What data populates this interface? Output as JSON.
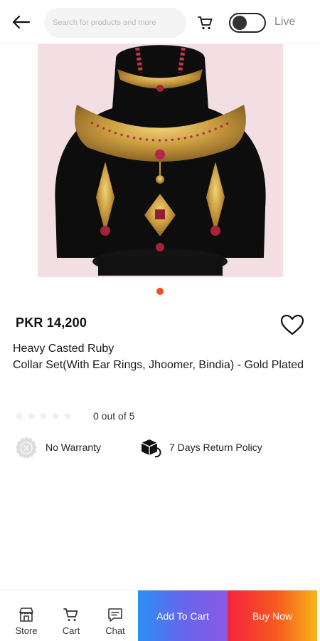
{
  "header": {
    "back_icon": "arrow-left-icon",
    "search_placeholder": "Search for products and more",
    "cart_icon": "cart-icon",
    "live_toggle": {
      "state": "off",
      "label": "Live"
    }
  },
  "product": {
    "image_description_icon": "jewelry-photo",
    "image_count": 1,
    "active_image": 1,
    "price": "PKR 14,200",
    "title": "Heavy Casted Ruby\nCollar  Set(With Ear Rings, Jhoomer, Bindia) - Gold Plated",
    "rating": {
      "value": 0,
      "max": 5,
      "text": "0 out of 5"
    },
    "warranty": {
      "icon": "no-warranty-icon",
      "text": "No Warranty"
    },
    "return_policy": {
      "icon": "return-box-icon",
      "text": "7 Days Return Policy"
    },
    "wishlist_icon": "heart-icon"
  },
  "bottom_nav": {
    "items": [
      {
        "label": "Store",
        "icon": "store-icon"
      },
      {
        "label": "Cart",
        "icon": "cart-icon"
      },
      {
        "label": "Chat",
        "icon": "chat-icon"
      }
    ],
    "add_to_cart_label": "Add To Cart",
    "buy_now_label": "Buy Now"
  },
  "colors": {
    "accent_dot": "#f04c1e",
    "add_to_cart_gradient": [
      "#2a8ff5",
      "#8b5ae5"
    ],
    "buy_now_gradient": [
      "#f5233f",
      "#f7b51a"
    ]
  }
}
